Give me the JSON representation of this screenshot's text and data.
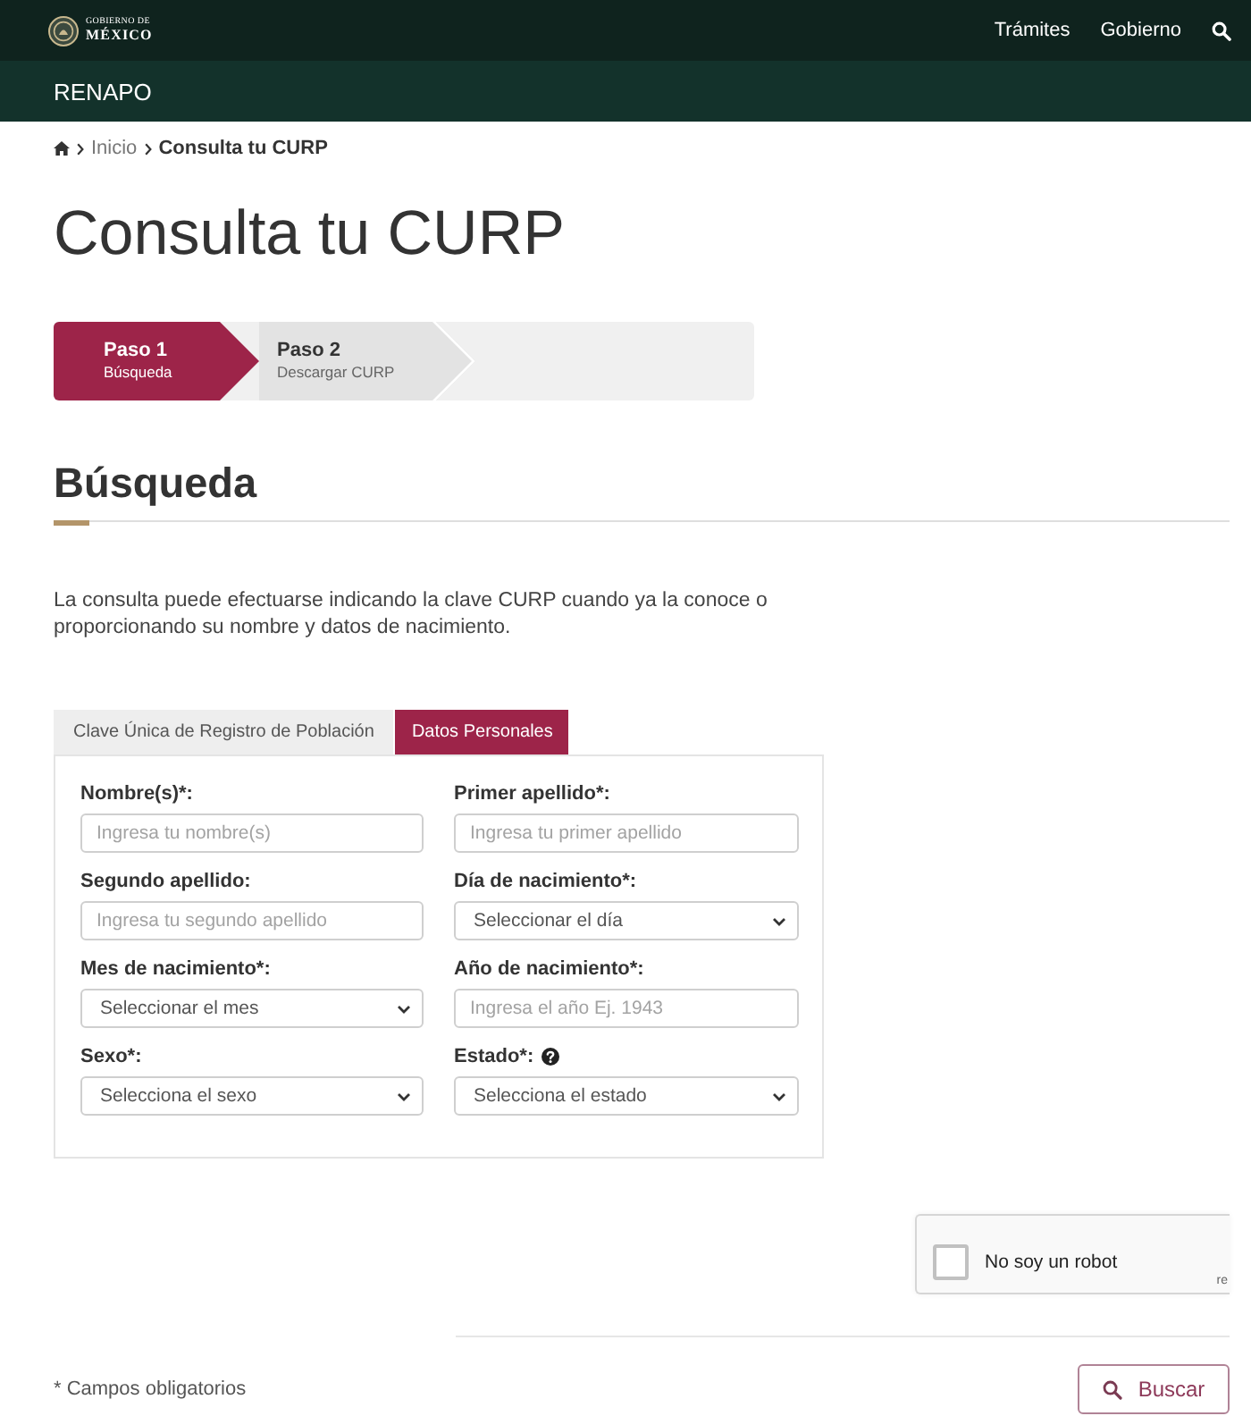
{
  "header": {
    "logo_text": [
      "GOBIERNO DE",
      "MÉXICO"
    ],
    "nav": [
      {
        "label": "Trámites"
      },
      {
        "label": "Gobierno"
      }
    ]
  },
  "subheader": {
    "title": "RENAPO"
  },
  "breadcrumb": [
    {
      "label": "Inicio",
      "kind": "link"
    },
    {
      "label": "Consulta tu CURP",
      "kind": "current"
    }
  ],
  "page_title": "Consulta tu CURP",
  "stepper": [
    {
      "title": "Paso 1",
      "subtitle": "Búsqueda",
      "selected": true
    },
    {
      "title": "Paso 2",
      "subtitle": "Descargar CURP",
      "selected": false
    }
  ],
  "section": {
    "title": "Búsqueda",
    "description": "La consulta puede efectuarse indicando la clave CURP cuando ya la conoce o proporcionando su nombre y datos de nacimiento."
  },
  "tabs": [
    {
      "label": "Clave Única de Registro de Población",
      "selected": false
    },
    {
      "label": "Datos Personales",
      "selected": true
    }
  ],
  "form": {
    "fields": [
      {
        "label": "Nombre(s)*:",
        "kind": "text",
        "placeholder": "Ingresa tu nombre(s)",
        "help": false
      },
      {
        "label": "Primer apellido*:",
        "kind": "text",
        "placeholder": "Ingresa tu primer apellido",
        "help": false
      },
      {
        "label": "Segundo apellido:",
        "kind": "text",
        "placeholder": "Ingresa tu segundo apellido",
        "help": false
      },
      {
        "label": "Día de nacimiento*:",
        "kind": "select",
        "value": "Seleccionar el día",
        "help": false
      },
      {
        "label": "Mes de nacimiento*:",
        "kind": "select",
        "value": "Seleccionar el mes",
        "help": false
      },
      {
        "label": "Año de nacimiento*:",
        "kind": "text",
        "placeholder": "Ingresa el año Ej. 1943",
        "help": false
      },
      {
        "label": "Sexo*:",
        "kind": "select",
        "value": "Selecciona el sexo",
        "help": false
      },
      {
        "label": "Estado*:",
        "kind": "select",
        "value": "Selecciona el estado",
        "help": true
      }
    ]
  },
  "captcha": {
    "label": "No soy un robot",
    "checked": false,
    "brand": "re"
  },
  "footer": {
    "note": "* Campos obligatorios",
    "button": "Buscar"
  }
}
